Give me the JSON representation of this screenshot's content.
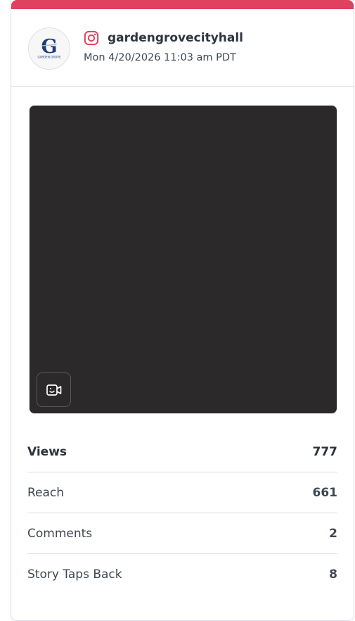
{
  "post": {
    "account": "gardengrovecityhall",
    "timestamp": "Mon 4/20/2026 11:03 am PDT",
    "platform_icon": "instagram-icon",
    "avatar_text": {
      "letter": "G",
      "caption": "GARDEN GROVE"
    },
    "media_type_icon": "video-camera-icon"
  },
  "colors": {
    "accent": "#e0415f",
    "media_bg": "#2b292a"
  },
  "metrics": [
    {
      "label": "Views",
      "value": "777"
    },
    {
      "label": "Reach",
      "value": "661"
    },
    {
      "label": "Comments",
      "value": "2"
    },
    {
      "label": "Story Taps Back",
      "value": "8"
    }
  ]
}
